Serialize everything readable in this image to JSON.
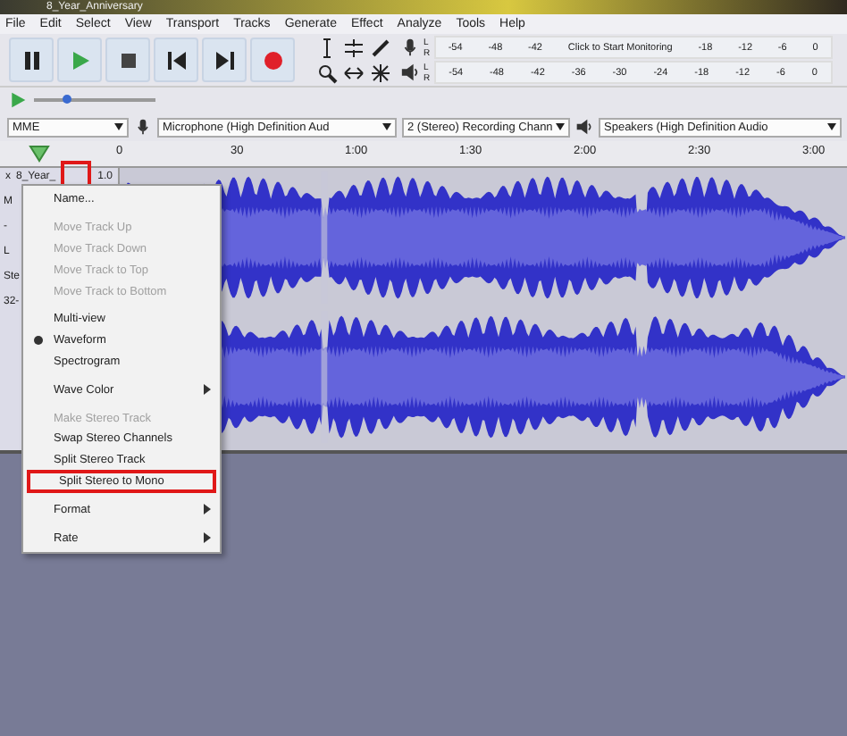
{
  "window": {
    "title": "8_Year_Anniversary"
  },
  "menu_bar": [
    "File",
    "Edit",
    "Select",
    "View",
    "Transport",
    "Tracks",
    "Generate",
    "Effect",
    "Analyze",
    "Tools",
    "Help"
  ],
  "transport": [
    {
      "kind": "pause"
    },
    {
      "kind": "play"
    },
    {
      "kind": "stop"
    },
    {
      "kind": "start"
    },
    {
      "kind": "end"
    },
    {
      "kind": "record"
    }
  ],
  "meters": [
    {
      "kind": "record",
      "channels": [
        "L",
        "R"
      ],
      "labels": [
        "-54",
        "-48",
        "-42",
        "Click to Start Monitoring",
        "-18",
        "-12",
        "-6",
        "0"
      ]
    },
    {
      "kind": "play",
      "channels": [
        "L",
        "R"
      ],
      "labels": [
        "-54",
        "-48",
        "-42",
        "-36",
        "-30",
        "-24",
        "-18",
        "-12",
        "-6",
        "0"
      ]
    }
  ],
  "speed": {
    "level": 0.27
  },
  "devices": {
    "host": "MME",
    "input": "Microphone (High Definition Aud",
    "channels": "2 (Stereo) Recording Chann",
    "output": "Speakers (High Definition Audio"
  },
  "ruler": [
    "0",
    "30",
    "1:00",
    "1:30",
    "2:00",
    "2:30",
    "3:00"
  ],
  "track": {
    "close": "x",
    "name": "8_Year_",
    "gain": "1.0",
    "side_labels": [
      "M",
      "-",
      "L",
      "Ste",
      "32-"
    ]
  },
  "track_menu": [
    {
      "kind": "item",
      "label": "Name...",
      "disabled": false,
      "checked": false,
      "submenu": false,
      "highlighted": false
    },
    {
      "kind": "separator"
    },
    {
      "kind": "item",
      "label": "Move Track Up",
      "disabled": true,
      "checked": false,
      "submenu": false,
      "highlighted": false
    },
    {
      "kind": "item",
      "label": "Move Track Down",
      "disabled": true,
      "checked": false,
      "submenu": false,
      "highlighted": false
    },
    {
      "kind": "item",
      "label": "Move Track to Top",
      "disabled": true,
      "checked": false,
      "submenu": false,
      "highlighted": false
    },
    {
      "kind": "item",
      "label": "Move Track to Bottom",
      "disabled": true,
      "checked": false,
      "submenu": false,
      "highlighted": false
    },
    {
      "kind": "separator"
    },
    {
      "kind": "item",
      "label": "Multi-view",
      "disabled": false,
      "checked": false,
      "submenu": false,
      "highlighted": false
    },
    {
      "kind": "item",
      "label": "Waveform",
      "disabled": false,
      "checked": true,
      "submenu": false,
      "highlighted": false
    },
    {
      "kind": "item",
      "label": "Spectrogram",
      "disabled": false,
      "checked": false,
      "submenu": false,
      "highlighted": false
    },
    {
      "kind": "separator"
    },
    {
      "kind": "item",
      "label": "Wave Color",
      "disabled": false,
      "checked": false,
      "submenu": true,
      "highlighted": false
    },
    {
      "kind": "separator"
    },
    {
      "kind": "item",
      "label": "Make Stereo Track",
      "disabled": true,
      "checked": false,
      "submenu": false,
      "highlighted": false
    },
    {
      "kind": "item",
      "label": "Swap Stereo Channels",
      "disabled": false,
      "checked": false,
      "submenu": false,
      "highlighted": false
    },
    {
      "kind": "item",
      "label": "Split Stereo Track",
      "disabled": false,
      "checked": false,
      "submenu": false,
      "highlighted": false
    },
    {
      "kind": "item",
      "label": "Split Stereo to Mono",
      "disabled": false,
      "checked": false,
      "submenu": false,
      "highlighted": true
    },
    {
      "kind": "separator"
    },
    {
      "kind": "item",
      "label": "Format",
      "disabled": false,
      "checked": false,
      "submenu": true,
      "highlighted": false
    },
    {
      "kind": "separator"
    },
    {
      "kind": "item",
      "label": "Rate",
      "disabled": false,
      "checked": false,
      "submenu": true,
      "highlighted": false
    }
  ]
}
